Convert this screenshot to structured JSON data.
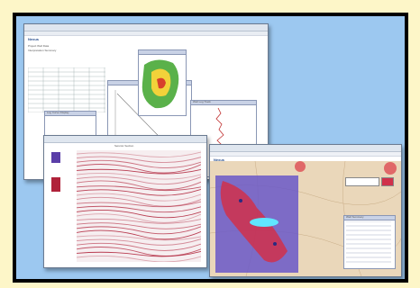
{
  "dashboard": {
    "logo_text": "Nexus",
    "header_lines": [
      "Project Well Data",
      "Interpretation Summary"
    ],
    "table_rows": 10,
    "subwindow_titles": [
      "Log Curve Display",
      "Well Log Track"
    ]
  },
  "seismic": {
    "title": "Seismic Section"
  },
  "map": {
    "logo_text": "Nexus",
    "popup_title": "Well Summary"
  },
  "colors": {
    "background": "#fdf6c8",
    "frame": "#000000",
    "panel": "#9cc8f0",
    "contour_green": "#5ab14a",
    "contour_yellow": "#f2d23a",
    "contour_red": "#d8402c",
    "seismic_red": "#b0223a",
    "seismic_purple": "#5a3ea8",
    "map_purple": "#6a58c8",
    "map_red": "#d0304a",
    "map_cyan": "#5fe6ff"
  },
  "icons": [
    "contour-map-icon",
    "seismic-icon",
    "gis-map-icon"
  ]
}
